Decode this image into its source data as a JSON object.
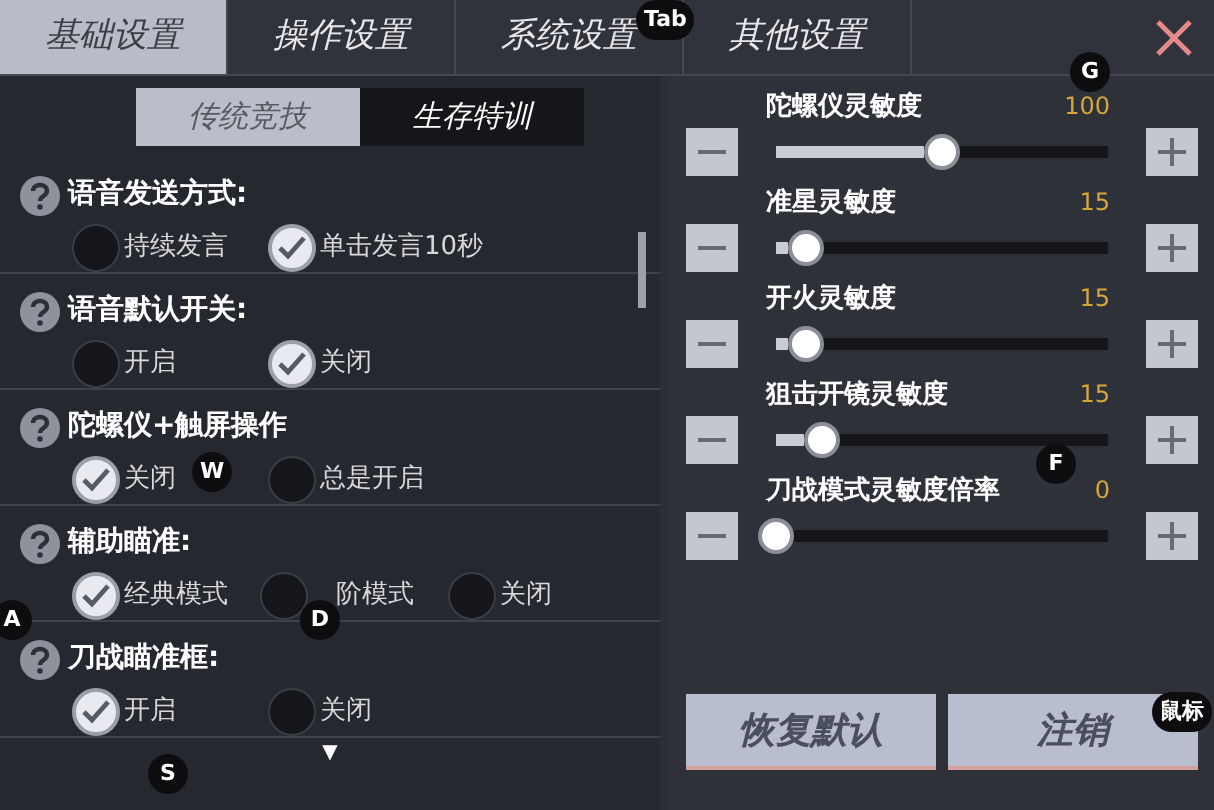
{
  "tabs": [
    {
      "label": "基础设置",
      "selected": true
    },
    {
      "label": "操作设置",
      "selected": false
    },
    {
      "label": "系统设置",
      "selected": false
    },
    {
      "label": "其他设置",
      "selected": false
    }
  ],
  "subtabs": [
    {
      "label": "传统竞技",
      "selected": true
    },
    {
      "label": "生存特训",
      "selected": false
    }
  ],
  "settings": [
    {
      "title": "语音发送方式:",
      "options": [
        {
          "label": "持续发言",
          "selected": false
        },
        {
          "label": "单击发言10秒",
          "selected": true
        }
      ]
    },
    {
      "title": "语音默认开关:",
      "options": [
        {
          "label": "开启",
          "selected": false
        },
        {
          "label": "关闭",
          "selected": true
        }
      ]
    },
    {
      "title": "陀螺仪+触屏操作",
      "options": [
        {
          "label": "关闭",
          "selected": true
        },
        {
          "label": "总是开启",
          "selected": false
        }
      ]
    },
    {
      "title": "辅助瞄准:",
      "options": [
        {
          "label": "经典模式",
          "selected": true
        },
        {
          "label": "阶模式",
          "selected": false
        },
        {
          "label": "关闭",
          "selected": false
        }
      ]
    },
    {
      "title": "刀战瞄准框:",
      "options": [
        {
          "label": "开启",
          "selected": true
        },
        {
          "label": "关闭",
          "selected": false
        }
      ]
    }
  ],
  "more_indicator": "▼",
  "sliders": [
    {
      "label": "陀螺仪灵敏度",
      "reading": "100",
      "level": 0.5
    },
    {
      "label": "准星灵敏度",
      "reading": "15",
      "level": 0.09
    },
    {
      "label": "开火灵敏度",
      "reading": "15",
      "level": 0.09
    },
    {
      "label": "狙击开镜灵敏度",
      "reading": "15",
      "level": 0.14
    },
    {
      "label": "刀战模式灵敏度倍率",
      "reading": "0",
      "level": 0
    }
  ],
  "buttons": [
    "恢复默认",
    "注销"
  ],
  "key_hints": [
    "Tab",
    "G",
    "W",
    "A",
    "D",
    "F",
    "S",
    "鼠标"
  ]
}
